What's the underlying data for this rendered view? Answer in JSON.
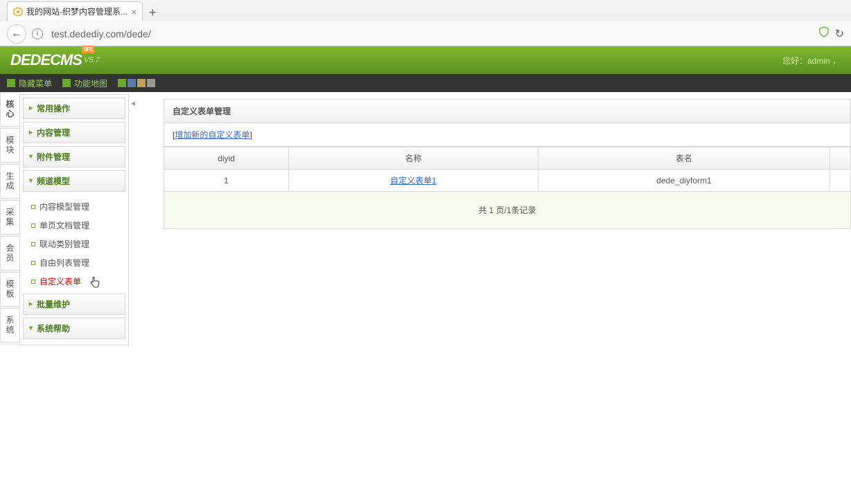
{
  "browser": {
    "tab_title": "我的网站-织梦内容管理系...",
    "url": "test.dedediy.com/dede/"
  },
  "header": {
    "logo_main": "DEDECMS",
    "version": "V5.7",
    "sp_badge": "SP1",
    "greeting": "您好：admin ，"
  },
  "menubar": {
    "hide_menu": "隐藏菜单",
    "site_map": "功能地图",
    "colors": [
      "#6fa82f",
      "#5a7ca8",
      "#c29f5a",
      "#999999"
    ]
  },
  "vtabs": [
    "核心",
    "模块",
    "生成",
    "采集",
    "会员",
    "模板",
    "系统"
  ],
  "sidebar": {
    "sections": [
      {
        "label": "常用操作",
        "expanded": false
      },
      {
        "label": "内容管理",
        "expanded": false
      },
      {
        "label": "附件管理",
        "expanded": false
      },
      {
        "label": "频道模型",
        "expanded": true,
        "items": [
          {
            "label": "内容模型管理",
            "active": false
          },
          {
            "label": "单页文档管理",
            "active": false
          },
          {
            "label": "联动类别管理",
            "active": false
          },
          {
            "label": "自由列表管理",
            "active": false
          },
          {
            "label": "自定义表单",
            "active": true
          }
        ]
      },
      {
        "label": "批量维护",
        "expanded": false
      },
      {
        "label": "系统帮助",
        "expanded": false
      }
    ]
  },
  "content": {
    "title": "自定义表单管理",
    "add_link": "增加新的自定义表单",
    "columns": {
      "c1": "diyid",
      "c2": "名称",
      "c3": "表名",
      "c4": ""
    },
    "rows": [
      {
        "id": "1",
        "name": "自定义表单1",
        "table": "dede_diyform1"
      }
    ],
    "pager": "共 1 页/1条记录"
  }
}
